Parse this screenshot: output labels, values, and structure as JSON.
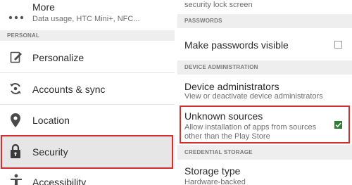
{
  "left_panel": {
    "more": {
      "title": "More",
      "subtitle": "Data usage, HTC Mini+, NFC..."
    },
    "section_personal": "PERSONAL",
    "items": [
      {
        "label": "Personalize",
        "icon": "personalize-icon"
      },
      {
        "label": "Accounts & sync",
        "icon": "sync-icon"
      },
      {
        "label": "Location",
        "icon": "location-pin-icon"
      },
      {
        "label": "Security",
        "icon": "lock-icon",
        "highlighted": true
      },
      {
        "label": "Accessibility",
        "icon": "accessibility-icon"
      }
    ]
  },
  "right_panel": {
    "top_fragment": "security lock screen",
    "section_passwords": "PASSWORDS",
    "make_passwords_visible": {
      "title": "Make passwords visible",
      "checked": false
    },
    "section_device_admin": "DEVICE ADMINISTRATION",
    "device_administrators": {
      "title": "Device administrators",
      "subtitle": "View or deactivate device administrators"
    },
    "unknown_sources": {
      "title": "Unknown sources",
      "subtitle_line1": "Allow installation of apps from sources",
      "subtitle_line2": "other than the Play Store",
      "checked": true,
      "highlighted": true
    },
    "section_credential_storage": "CREDENTIAL STORAGE",
    "storage_type": {
      "title": "Storage type",
      "subtitle": "Hardware-backed"
    }
  },
  "colors": {
    "highlight": "#d32f2f",
    "check": "#2e7d32",
    "security_row_bg": "#e6e6e6",
    "section_bg": "#eeeeee"
  }
}
